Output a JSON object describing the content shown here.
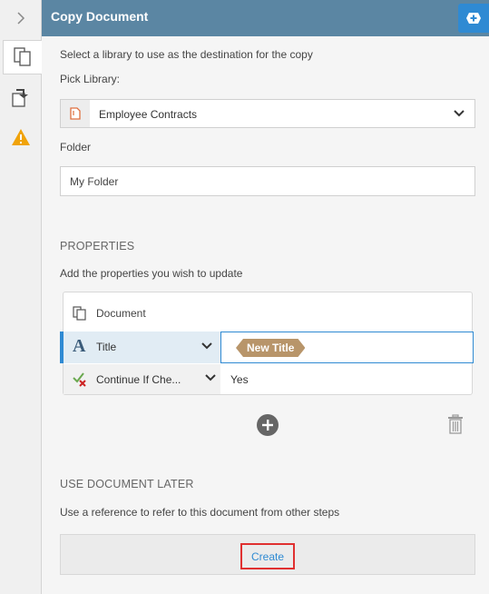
{
  "header": {
    "title": "Copy Document"
  },
  "main": {
    "intro": "Select a library to use as the destination for the copy",
    "pick_library_label": "Pick Library:",
    "library_value": "Employee Contracts",
    "folder_label": "Folder",
    "folder_value": "My Folder"
  },
  "properties": {
    "heading": "PROPERTIES",
    "description": "Add the properties you wish to update",
    "document_label": "Document",
    "rows": [
      {
        "label": "Title",
        "value": "New Title"
      },
      {
        "label": "Continue If Che...",
        "value": "Yes"
      }
    ]
  },
  "later": {
    "heading": "USE DOCUMENT LATER",
    "description": "Use a reference to refer to this document from other steps",
    "create_label": "Create"
  },
  "colors": {
    "header_bg": "#5b86a3",
    "accent": "#2f8ad3",
    "tag_bg": "#b8956a",
    "warning": "#f0a30a",
    "highlight_border": "#e03030"
  },
  "icons": [
    "chevron-right-icon",
    "copy-document-icon",
    "move-document-icon",
    "warning-icon",
    "add-icon",
    "document-icon",
    "chevron-down-icon",
    "text-a-icon",
    "checkmark-x-icon",
    "plus-circle-icon",
    "trash-icon"
  ]
}
